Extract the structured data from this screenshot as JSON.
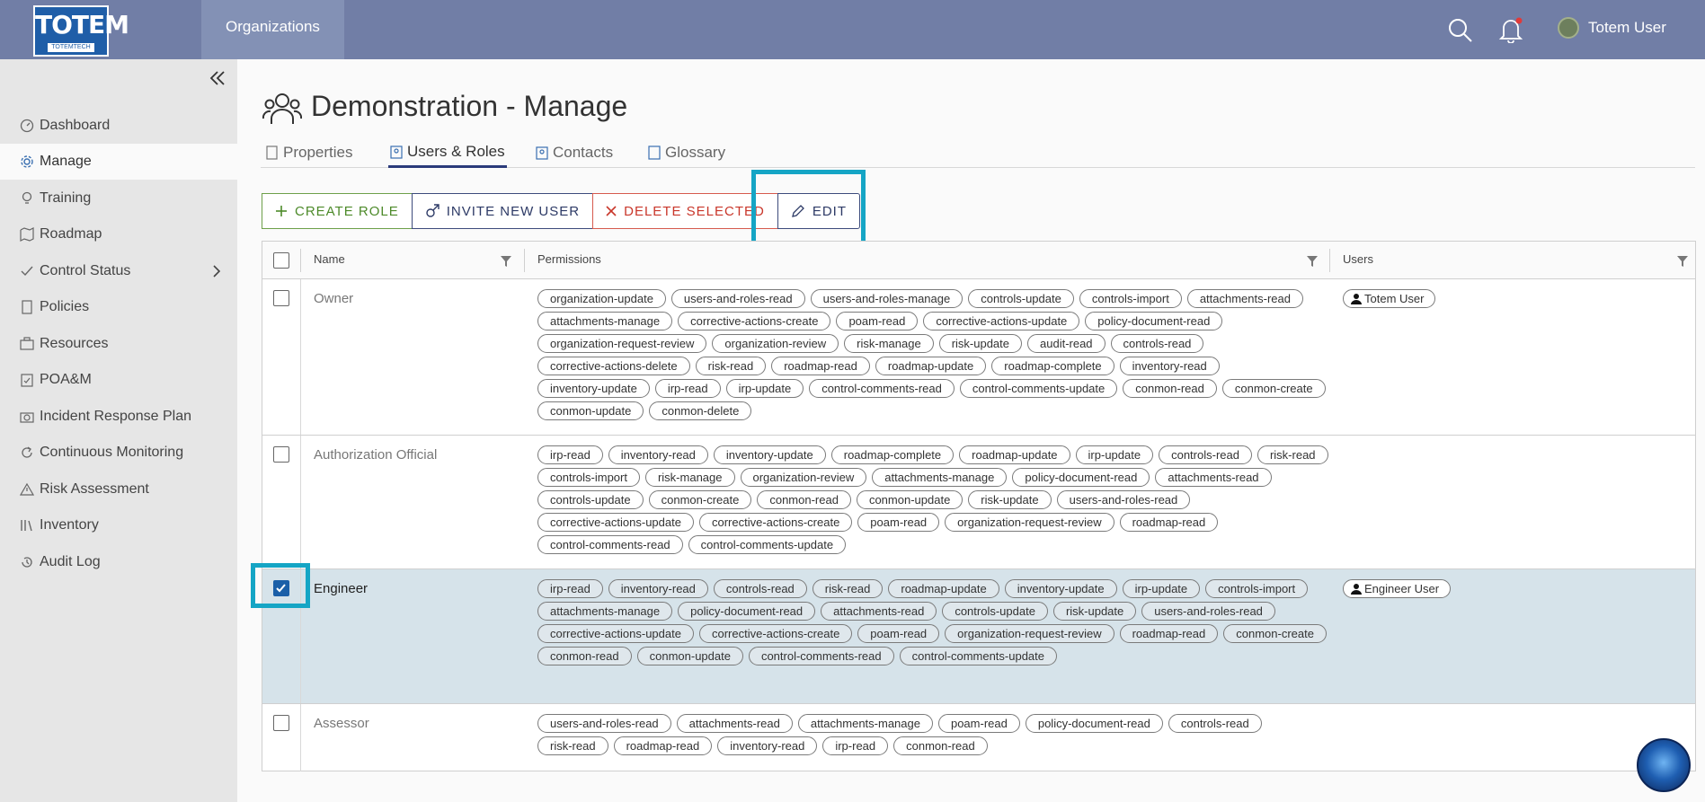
{
  "header": {
    "logo_text": "TOTEM",
    "logo_sub": "TOTEMTECH",
    "nav_organizations": "Organizations",
    "user_name": "Totem User",
    "icons": {
      "search": "search-icon",
      "notifications": "bell-icon",
      "avatar": "avatar"
    },
    "notification_dot_color": "#e03a3a"
  },
  "sidebar": {
    "items": [
      {
        "label": "Dashboard",
        "icon": "dashboard-icon"
      },
      {
        "label": "Manage",
        "icon": "gear-icon",
        "active": true
      },
      {
        "label": "Training",
        "icon": "lightbulb-icon"
      },
      {
        "label": "Roadmap",
        "icon": "map-icon"
      },
      {
        "label": "Control Status",
        "icon": "check-icon",
        "has_children": true
      },
      {
        "label": "Policies",
        "icon": "document-icon"
      },
      {
        "label": "Resources",
        "icon": "briefcase-icon"
      },
      {
        "label": "POA&M",
        "icon": "clipboard-icon"
      },
      {
        "label": "Incident Response Plan",
        "icon": "camera-icon"
      },
      {
        "label": "Continuous Monitoring",
        "icon": "refresh-icon"
      },
      {
        "label": "Risk Assessment",
        "icon": "warning-icon"
      },
      {
        "label": "Inventory",
        "icon": "library-icon"
      },
      {
        "label": "Audit Log",
        "icon": "history-icon"
      }
    ]
  },
  "page": {
    "title": "Demonstration - Manage",
    "tabs": [
      {
        "label": "Properties"
      },
      {
        "label": "Users & Roles",
        "active": true
      },
      {
        "label": "Contacts"
      },
      {
        "label": "Glossary"
      }
    ]
  },
  "toolbar": {
    "create_role": "CREATE ROLE",
    "invite_user": "INVITE NEW USER",
    "delete_selected": "DELETE SELECTED",
    "edit": "EDIT"
  },
  "table": {
    "columns": [
      "Name",
      "Permissions",
      "Users"
    ],
    "rows": [
      {
        "name": "Owner",
        "selected": false,
        "permissions": [
          "organization-update",
          "users-and-roles-read",
          "users-and-roles-manage",
          "controls-update",
          "controls-import",
          "attachments-read",
          "attachments-manage",
          "corrective-actions-create",
          "poam-read",
          "corrective-actions-update",
          "policy-document-read",
          "organization-request-review",
          "organization-review",
          "risk-manage",
          "risk-update",
          "audit-read",
          "controls-read",
          "corrective-actions-delete",
          "risk-read",
          "roadmap-read",
          "roadmap-update",
          "roadmap-complete",
          "inventory-read",
          "inventory-update",
          "irp-read",
          "irp-update",
          "control-comments-read",
          "control-comments-update",
          "conmon-read",
          "conmon-create",
          "conmon-update",
          "conmon-delete"
        ],
        "users": [
          "Totem User"
        ]
      },
      {
        "name": "Authorization Official",
        "selected": false,
        "permissions": [
          "irp-read",
          "inventory-read",
          "inventory-update",
          "roadmap-complete",
          "roadmap-update",
          "irp-update",
          "controls-read",
          "risk-read",
          "controls-import",
          "risk-manage",
          "organization-review",
          "attachments-manage",
          "policy-document-read",
          "attachments-read",
          "controls-update",
          "conmon-create",
          "conmon-read",
          "conmon-update",
          "risk-update",
          "users-and-roles-read",
          "corrective-actions-update",
          "corrective-actions-create",
          "poam-read",
          "organization-request-review",
          "roadmap-read",
          "control-comments-read",
          "control-comments-update"
        ],
        "users": []
      },
      {
        "name": "Engineer",
        "selected": true,
        "permissions": [
          "irp-read",
          "inventory-read",
          "controls-read",
          "risk-read",
          "roadmap-update",
          "inventory-update",
          "irp-update",
          "controls-import",
          "attachments-manage",
          "policy-document-read",
          "attachments-read",
          "controls-update",
          "risk-update",
          "users-and-roles-read",
          "corrective-actions-update",
          "corrective-actions-create",
          "poam-read",
          "organization-request-review",
          "roadmap-read",
          "conmon-create",
          "conmon-read",
          "conmon-update",
          "control-comments-read",
          "control-comments-update"
        ],
        "users": [
          "Engineer User"
        ]
      },
      {
        "name": "Assessor",
        "selected": false,
        "permissions": [
          "users-and-roles-read",
          "attachments-read",
          "attachments-manage",
          "poam-read",
          "policy-document-read",
          "controls-read",
          "risk-read",
          "roadmap-read",
          "inventory-read",
          "irp-read",
          "conmon-read"
        ],
        "users": []
      }
    ]
  },
  "colors": {
    "header_bg": "#717ea6",
    "highlight": "#15a5c5",
    "create": "#4d8a2a",
    "invite": "#2d3a66",
    "delete": "#c9372b",
    "selected_row": "#d6e3ea"
  }
}
